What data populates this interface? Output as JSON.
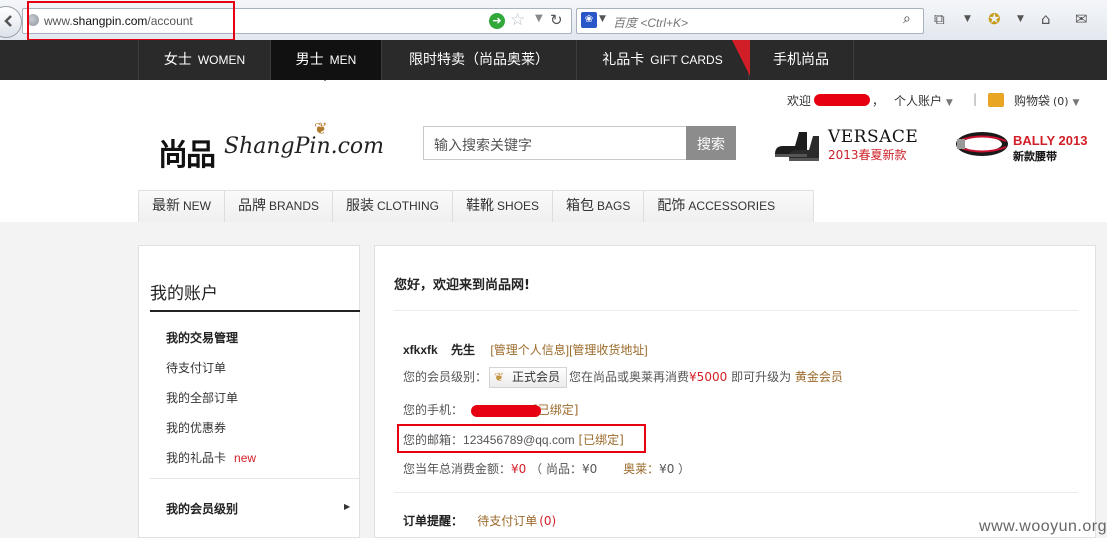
{
  "browser": {
    "url_prefix": "www.",
    "url_domain": "shangpin.com",
    "url_path": "/account",
    "search_placeholder": "百度 <Ctrl+K>"
  },
  "topnav": {
    "items": [
      {
        "cn": "女士",
        "en": "WOMEN"
      },
      {
        "cn": "男士",
        "en": "MEN"
      },
      {
        "cn": "限时特卖（尚品奥莱）",
        "en": ""
      },
      {
        "cn": "礼品卡",
        "en": "GIFT CARDS"
      },
      {
        "cn": "手机尚品",
        "en": ""
      }
    ],
    "active": "MEN"
  },
  "header": {
    "welcome": "欢迎",
    "comma": "，",
    "account": "个人账户",
    "divider": "|",
    "bag": "购物袋",
    "bag_count": "(0)",
    "logo_mark": "尚品",
    "logo_text": "ShangPin.com",
    "search_placeholder": "输入搜索关键字",
    "search_button": "搜索",
    "ad1_brand": "VERSACE",
    "ad1_sub": "2013春夏新款",
    "ad2_brand": "BALLY 2013",
    "ad2_sub": "新款腰带"
  },
  "catnav": {
    "items": [
      {
        "cn": "最新",
        "en": "NEW"
      },
      {
        "cn": "品牌",
        "en": "BRANDS"
      },
      {
        "cn": "服装",
        "en": "CLOTHING"
      },
      {
        "cn": "鞋靴",
        "en": "SHOES"
      },
      {
        "cn": "箱包",
        "en": "BAGS"
      },
      {
        "cn": "配饰",
        "en": "ACCESSORIES"
      }
    ]
  },
  "sidebar": {
    "title": "我的账户",
    "section1": "我的交易管理",
    "items": [
      "待支付订单",
      "我的全部订单",
      "我的优惠券",
      "我的礼品卡"
    ],
    "new_badge": "new",
    "section2": "我的会员级别"
  },
  "main": {
    "greeting": "您好，欢迎来到尚品网!",
    "username": "xfkxfk",
    "honorific": "先生",
    "link_profile": "[管理个人信息]",
    "link_address": "[管理收货地址]",
    "level_label": "您的会员级别：",
    "level_value": "正式会员",
    "upgrade_pre": "您在尚品或奥莱再消费",
    "upgrade_amount": "¥5000",
    "upgrade_mid": "即可升级为",
    "upgrade_level": "黄金会员",
    "phone_label": "您的手机：",
    "phone_status": "[已绑定]",
    "email_label": "您的邮箱：",
    "email_value": "123456789@qq.com",
    "email_status": "[已绑定]",
    "spend_label": "您当年总消费金额：",
    "spend_total": "¥0",
    "spend_sp_label": "（ 尚品：",
    "spend_sp": "¥0",
    "spend_ol_label": "奥莱：",
    "spend_ol": "¥0 ）",
    "order_label": "订单提醒：",
    "order_pending": "待支付订单",
    "order_count": "(0)"
  },
  "watermark": "www.wooyun.org"
}
